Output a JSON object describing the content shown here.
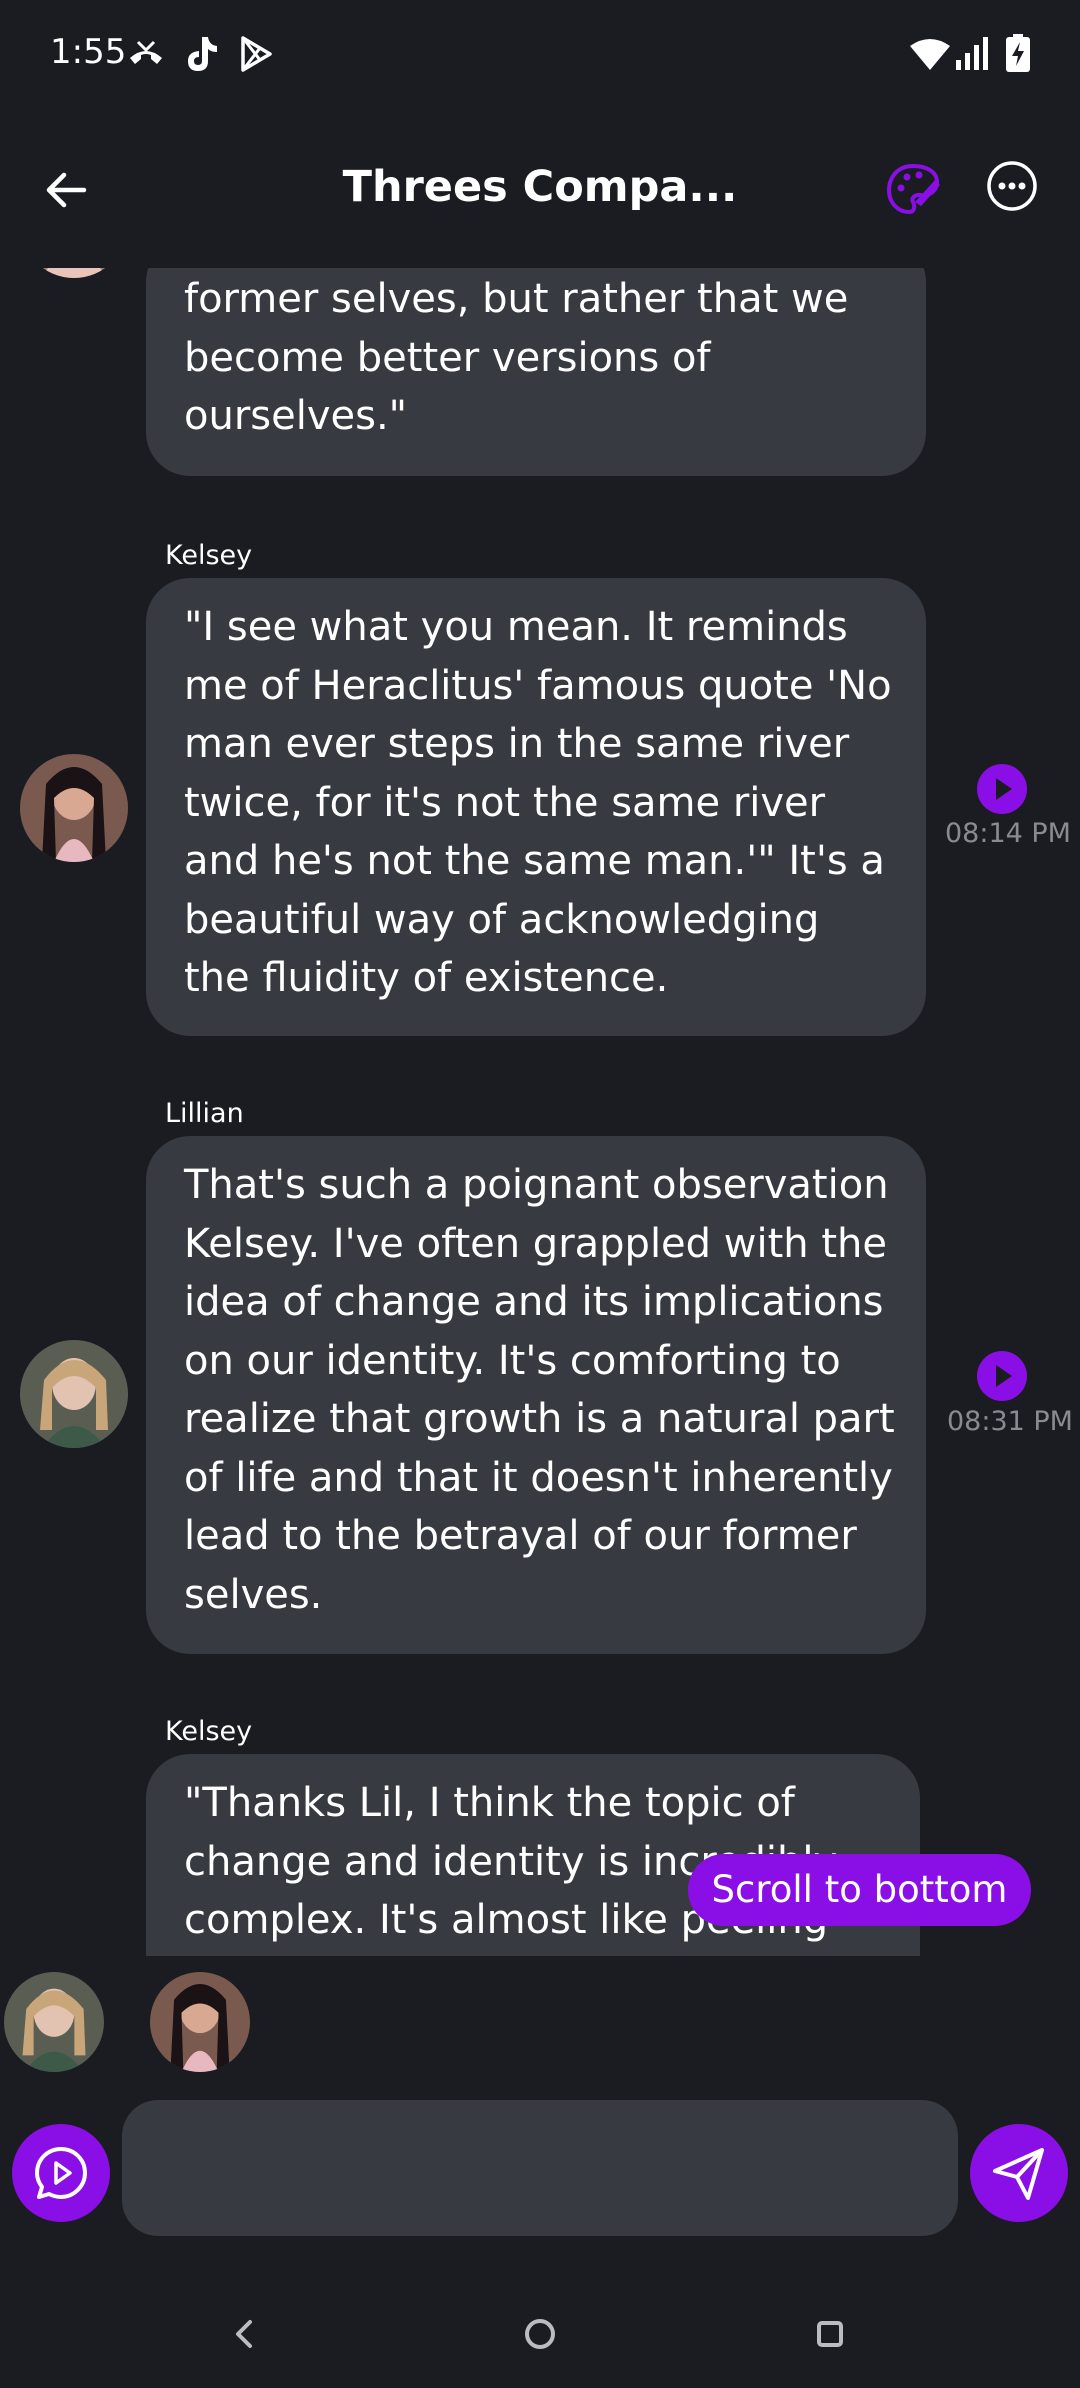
{
  "status_bar": {
    "time": "1:55",
    "left_icons": [
      "missed-call-icon",
      "tiktok-icon",
      "play-store-icon"
    ],
    "right_icons": [
      "wifi-icon",
      "signal-icon",
      "battery-charging-icon"
    ]
  },
  "header": {
    "title": "Threes Compa...",
    "accent_color": "#8a0fe6"
  },
  "messages": [
    {
      "sender": "",
      "text": "former selves, but rather that we become better versions of ourselves.\"",
      "time": ""
    },
    {
      "sender": "Kelsey",
      "text": "\"I see what you mean. It reminds me of Heraclitus' famous quote 'No man ever steps in the same river twice, for it's not the same river and he's not the same man.'\" It's a beautiful way of acknowledging the fluidity of existence.",
      "time": "08:14 PM"
    },
    {
      "sender": "Lillian",
      "text": "That's such a poignant observation Kelsey. I've often grappled with the idea of change and its implications on our identity. It's comforting to realize that growth is a natural part of life and that it doesn't inherently lead to the betrayal of our former selves.",
      "time": "08:31 PM"
    },
    {
      "sender": "Kelsey",
      "text": "\"Thanks Lil, I think the topic of change and identity is incredibly complex. It's almost like peeling",
      "time": ""
    }
  ],
  "scroll_button": "Scroll to bottom",
  "participants": [
    "Lillian",
    "Kelsey"
  ],
  "input": {
    "value": "",
    "placeholder": ""
  },
  "nav": [
    "back",
    "home",
    "recents"
  ]
}
